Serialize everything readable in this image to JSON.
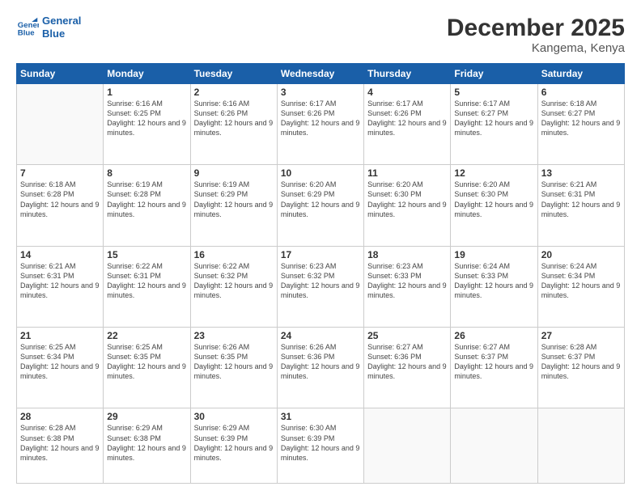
{
  "logo": {
    "line1": "General",
    "line2": "Blue"
  },
  "header": {
    "month": "December 2025",
    "location": "Kangema, Kenya"
  },
  "weekdays": [
    "Sunday",
    "Monday",
    "Tuesday",
    "Wednesday",
    "Thursday",
    "Friday",
    "Saturday"
  ],
  "weeks": [
    [
      {
        "day": "",
        "sunrise": "",
        "sunset": "",
        "daylight": ""
      },
      {
        "day": "1",
        "sunrise": "Sunrise: 6:16 AM",
        "sunset": "Sunset: 6:25 PM",
        "daylight": "Daylight: 12 hours and 9 minutes."
      },
      {
        "day": "2",
        "sunrise": "Sunrise: 6:16 AM",
        "sunset": "Sunset: 6:26 PM",
        "daylight": "Daylight: 12 hours and 9 minutes."
      },
      {
        "day": "3",
        "sunrise": "Sunrise: 6:17 AM",
        "sunset": "Sunset: 6:26 PM",
        "daylight": "Daylight: 12 hours and 9 minutes."
      },
      {
        "day": "4",
        "sunrise": "Sunrise: 6:17 AM",
        "sunset": "Sunset: 6:26 PM",
        "daylight": "Daylight: 12 hours and 9 minutes."
      },
      {
        "day": "5",
        "sunrise": "Sunrise: 6:17 AM",
        "sunset": "Sunset: 6:27 PM",
        "daylight": "Daylight: 12 hours and 9 minutes."
      },
      {
        "day": "6",
        "sunrise": "Sunrise: 6:18 AM",
        "sunset": "Sunset: 6:27 PM",
        "daylight": "Daylight: 12 hours and 9 minutes."
      }
    ],
    [
      {
        "day": "7",
        "sunrise": "Sunrise: 6:18 AM",
        "sunset": "Sunset: 6:28 PM",
        "daylight": "Daylight: 12 hours and 9 minutes."
      },
      {
        "day": "8",
        "sunrise": "Sunrise: 6:19 AM",
        "sunset": "Sunset: 6:28 PM",
        "daylight": "Daylight: 12 hours and 9 minutes."
      },
      {
        "day": "9",
        "sunrise": "Sunrise: 6:19 AM",
        "sunset": "Sunset: 6:29 PM",
        "daylight": "Daylight: 12 hours and 9 minutes."
      },
      {
        "day": "10",
        "sunrise": "Sunrise: 6:20 AM",
        "sunset": "Sunset: 6:29 PM",
        "daylight": "Daylight: 12 hours and 9 minutes."
      },
      {
        "day": "11",
        "sunrise": "Sunrise: 6:20 AM",
        "sunset": "Sunset: 6:30 PM",
        "daylight": "Daylight: 12 hours and 9 minutes."
      },
      {
        "day": "12",
        "sunrise": "Sunrise: 6:20 AM",
        "sunset": "Sunset: 6:30 PM",
        "daylight": "Daylight: 12 hours and 9 minutes."
      },
      {
        "day": "13",
        "sunrise": "Sunrise: 6:21 AM",
        "sunset": "Sunset: 6:31 PM",
        "daylight": "Daylight: 12 hours and 9 minutes."
      }
    ],
    [
      {
        "day": "14",
        "sunrise": "Sunrise: 6:21 AM",
        "sunset": "Sunset: 6:31 PM",
        "daylight": "Daylight: 12 hours and 9 minutes."
      },
      {
        "day": "15",
        "sunrise": "Sunrise: 6:22 AM",
        "sunset": "Sunset: 6:31 PM",
        "daylight": "Daylight: 12 hours and 9 minutes."
      },
      {
        "day": "16",
        "sunrise": "Sunrise: 6:22 AM",
        "sunset": "Sunset: 6:32 PM",
        "daylight": "Daylight: 12 hours and 9 minutes."
      },
      {
        "day": "17",
        "sunrise": "Sunrise: 6:23 AM",
        "sunset": "Sunset: 6:32 PM",
        "daylight": "Daylight: 12 hours and 9 minutes."
      },
      {
        "day": "18",
        "sunrise": "Sunrise: 6:23 AM",
        "sunset": "Sunset: 6:33 PM",
        "daylight": "Daylight: 12 hours and 9 minutes."
      },
      {
        "day": "19",
        "sunrise": "Sunrise: 6:24 AM",
        "sunset": "Sunset: 6:33 PM",
        "daylight": "Daylight: 12 hours and 9 minutes."
      },
      {
        "day": "20",
        "sunrise": "Sunrise: 6:24 AM",
        "sunset": "Sunset: 6:34 PM",
        "daylight": "Daylight: 12 hours and 9 minutes."
      }
    ],
    [
      {
        "day": "21",
        "sunrise": "Sunrise: 6:25 AM",
        "sunset": "Sunset: 6:34 PM",
        "daylight": "Daylight: 12 hours and 9 minutes."
      },
      {
        "day": "22",
        "sunrise": "Sunrise: 6:25 AM",
        "sunset": "Sunset: 6:35 PM",
        "daylight": "Daylight: 12 hours and 9 minutes."
      },
      {
        "day": "23",
        "sunrise": "Sunrise: 6:26 AM",
        "sunset": "Sunset: 6:35 PM",
        "daylight": "Daylight: 12 hours and 9 minutes."
      },
      {
        "day": "24",
        "sunrise": "Sunrise: 6:26 AM",
        "sunset": "Sunset: 6:36 PM",
        "daylight": "Daylight: 12 hours and 9 minutes."
      },
      {
        "day": "25",
        "sunrise": "Sunrise: 6:27 AM",
        "sunset": "Sunset: 6:36 PM",
        "daylight": "Daylight: 12 hours and 9 minutes."
      },
      {
        "day": "26",
        "sunrise": "Sunrise: 6:27 AM",
        "sunset": "Sunset: 6:37 PM",
        "daylight": "Daylight: 12 hours and 9 minutes."
      },
      {
        "day": "27",
        "sunrise": "Sunrise: 6:28 AM",
        "sunset": "Sunset: 6:37 PM",
        "daylight": "Daylight: 12 hours and 9 minutes."
      }
    ],
    [
      {
        "day": "28",
        "sunrise": "Sunrise: 6:28 AM",
        "sunset": "Sunset: 6:38 PM",
        "daylight": "Daylight: 12 hours and 9 minutes."
      },
      {
        "day": "29",
        "sunrise": "Sunrise: 6:29 AM",
        "sunset": "Sunset: 6:38 PM",
        "daylight": "Daylight: 12 hours and 9 minutes."
      },
      {
        "day": "30",
        "sunrise": "Sunrise: 6:29 AM",
        "sunset": "Sunset: 6:39 PM",
        "daylight": "Daylight: 12 hours and 9 minutes."
      },
      {
        "day": "31",
        "sunrise": "Sunrise: 6:30 AM",
        "sunset": "Sunset: 6:39 PM",
        "daylight": "Daylight: 12 hours and 9 minutes."
      },
      {
        "day": "",
        "sunrise": "",
        "sunset": "",
        "daylight": ""
      },
      {
        "day": "",
        "sunrise": "",
        "sunset": "",
        "daylight": ""
      },
      {
        "day": "",
        "sunrise": "",
        "sunset": "",
        "daylight": ""
      }
    ]
  ]
}
